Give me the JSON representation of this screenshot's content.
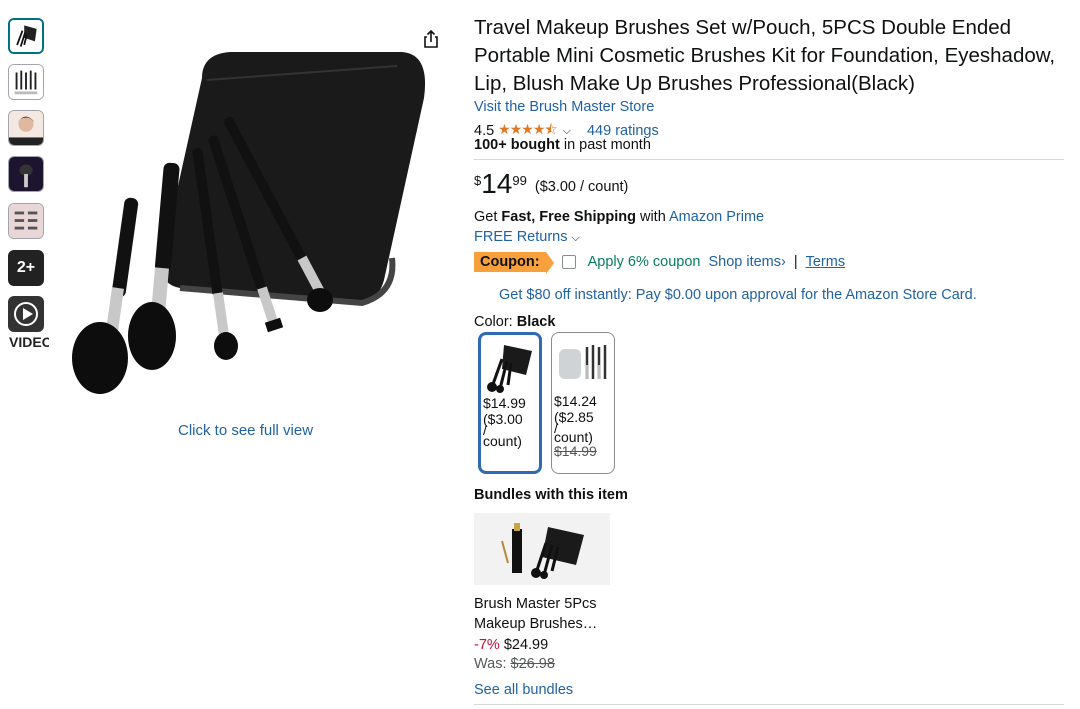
{
  "gallery": {
    "more_count": "2+",
    "video_label": "VIDEO",
    "full_view_link": "Click to see full view"
  },
  "product": {
    "title": "Travel Makeup Brushes Set w/Pouch, 5PCS Double Ended Portable Mini Cosmetic Brushes Kit for Foundation, Eyeshadow, Lip, Blush Make Up Brushes Professional(Black)",
    "store_link": "Visit the Brush Master Store",
    "rating_value": "4.5",
    "rating_stars": 4.5,
    "ratings_count": "449 ratings",
    "bought_bold": "100+ bought",
    "bought_rest": " in past month"
  },
  "price": {
    "currency": "$",
    "dollars": "14",
    "cents": "99",
    "unit": "($3.00 / count)"
  },
  "shipping": {
    "get": "Get ",
    "fast_free": "Fast, Free Shipping",
    "with": " with ",
    "prime": "Amazon Prime",
    "returns": "FREE Returns"
  },
  "coupon": {
    "badge": "Coupon:",
    "apply": "Apply 6% coupon",
    "shop_items": "Shop items›",
    "separator": "|",
    "terms": "Terms"
  },
  "card_offer": "Get $80 off instantly: Pay $0.00 upon approval for the Amazon Store Card.",
  "color": {
    "label": "Color: ",
    "selected": "Black",
    "options": [
      {
        "price": "$14.99",
        "unit_line1": "($3.00",
        "unit_line2": "/",
        "unit_line3": "count)"
      },
      {
        "price": "$14.24",
        "unit_line1": "($2.85",
        "unit_line2": "/",
        "unit_line3": "count)",
        "was": "$14.99"
      }
    ]
  },
  "bundles": {
    "heading": "Bundles with this item",
    "name": "Brush Master 5Pcs Makeup Brushes…",
    "discount": "-7%",
    "price": "$24.99",
    "was_label": "Was: ",
    "was_price": "$26.98",
    "see_all": "See all bundles"
  },
  "colors": {
    "link": "#2162a1",
    "star": "#de7921",
    "coupon_badge": "#f7a03c",
    "apply_green": "#067d62",
    "discount_red": "#cc0c39",
    "selected_border": "#2f6bb3"
  }
}
